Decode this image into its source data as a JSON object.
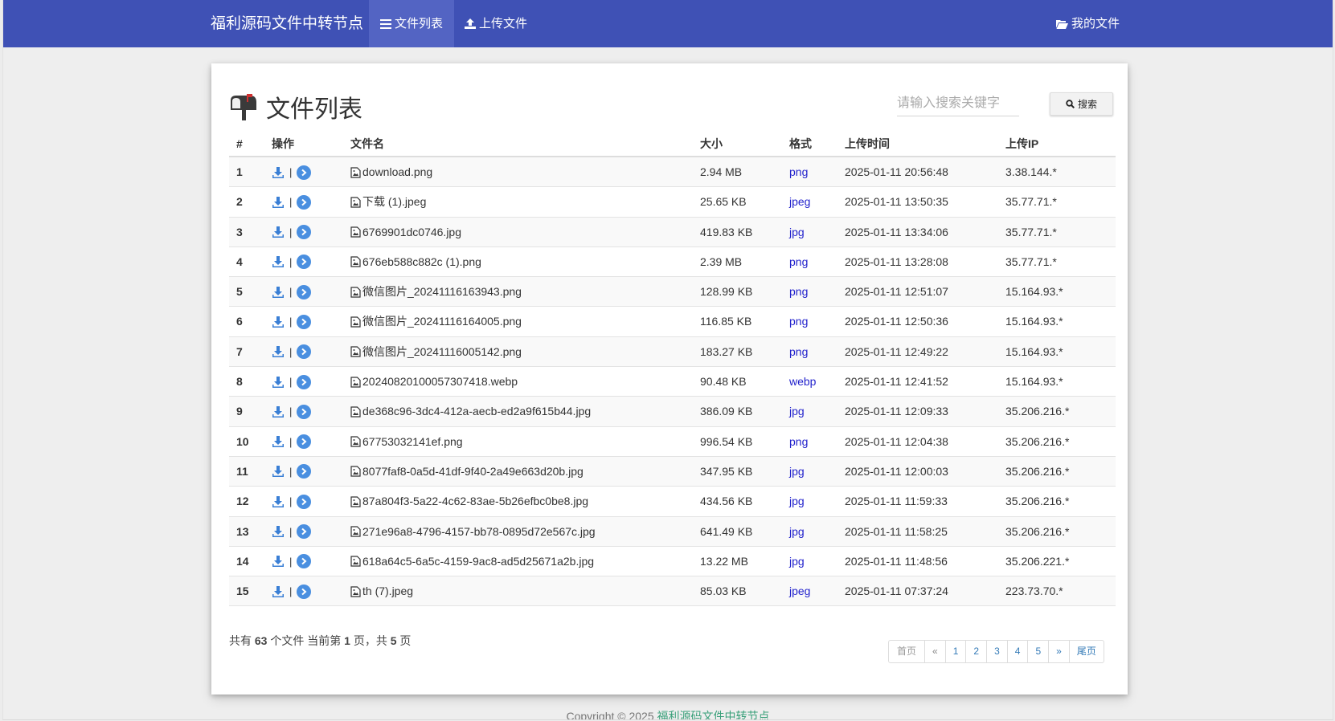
{
  "navbar": {
    "brand": "福利源码文件中转节点",
    "file_list": "文件列表",
    "upload": "上传文件",
    "my_files": "我的文件"
  },
  "page": {
    "title": "文件列表",
    "search_placeholder": "请输入搜索关键字",
    "search_label": "搜索"
  },
  "table": {
    "headers": {
      "num": "#",
      "op": "操作",
      "name": "文件名",
      "size": "大小",
      "format": "格式",
      "time": "上传时间",
      "ip": "上传IP"
    },
    "separator": "|",
    "rows": [
      {
        "num": "1",
        "name": "download.png",
        "size": "2.94 MB",
        "format": "png",
        "time": "2025-01-11 20:56:48",
        "ip": "3.38.144.*"
      },
      {
        "num": "2",
        "name": "下载 (1).jpeg",
        "size": "25.65 KB",
        "format": "jpeg",
        "time": "2025-01-11 13:50:35",
        "ip": "35.77.71.*"
      },
      {
        "num": "3",
        "name": "6769901dc0746.jpg",
        "size": "419.83 KB",
        "format": "jpg",
        "time": "2025-01-11 13:34:06",
        "ip": "35.77.71.*"
      },
      {
        "num": "4",
        "name": "676eb588c882c (1).png",
        "size": "2.39 MB",
        "format": "png",
        "time": "2025-01-11 13:28:08",
        "ip": "35.77.71.*"
      },
      {
        "num": "5",
        "name": "微信图片_20241116163943.png",
        "size": "128.99 KB",
        "format": "png",
        "time": "2025-01-11 12:51:07",
        "ip": "15.164.93.*"
      },
      {
        "num": "6",
        "name": "微信图片_20241116164005.png",
        "size": "116.85 KB",
        "format": "png",
        "time": "2025-01-11 12:50:36",
        "ip": "15.164.93.*"
      },
      {
        "num": "7",
        "name": "微信图片_20241116005142.png",
        "size": "183.27 KB",
        "format": "png",
        "time": "2025-01-11 12:49:22",
        "ip": "15.164.93.*"
      },
      {
        "num": "8",
        "name": "20240820100057307418.webp",
        "size": "90.48 KB",
        "format": "webp",
        "time": "2025-01-11 12:41:52",
        "ip": "15.164.93.*"
      },
      {
        "num": "9",
        "name": "de368c96-3dc4-412a-aecb-ed2a9f615b44.jpg",
        "size": "386.09 KB",
        "format": "jpg",
        "time": "2025-01-11 12:09:33",
        "ip": "35.206.216.*"
      },
      {
        "num": "10",
        "name": "67753032141ef.png",
        "size": "996.54 KB",
        "format": "png",
        "time": "2025-01-11 12:04:38",
        "ip": "35.206.216.*"
      },
      {
        "num": "11",
        "name": "8077faf8-0a5d-41df-9f40-2a49e663d20b.jpg",
        "size": "347.95 KB",
        "format": "jpg",
        "time": "2025-01-11 12:00:03",
        "ip": "35.206.216.*"
      },
      {
        "num": "12",
        "name": "87a804f3-5a22-4c62-83ae-5b26efbc0be8.jpg",
        "size": "434.56 KB",
        "format": "jpg",
        "time": "2025-01-11 11:59:33",
        "ip": "35.206.216.*"
      },
      {
        "num": "13",
        "name": "271e96a8-4796-4157-bb78-0895d72e567c.jpg",
        "size": "641.49 KB",
        "format": "jpg",
        "time": "2025-01-11 11:58:25",
        "ip": "35.206.216.*"
      },
      {
        "num": "14",
        "name": "618a64c5-6a5c-4159-9ac8-ad5d25671a2b.jpg",
        "size": "13.22 MB",
        "format": "jpg",
        "time": "2025-01-11 11:48:56",
        "ip": "35.206.221.*"
      },
      {
        "num": "15",
        "name": "th (7).jpeg",
        "size": "85.03 KB",
        "format": "jpeg",
        "time": "2025-01-11 07:37:24",
        "ip": "223.73.70.*"
      }
    ]
  },
  "summary": {
    "prefix": "共有",
    "total": "63",
    "mid1": "个文件 当前第",
    "current": "1",
    "mid2": "页，共",
    "pages": "5",
    "suffix": "页"
  },
  "pagination": {
    "first": "首页",
    "prev": "«",
    "pages": [
      "1",
      "2",
      "3",
      "4",
      "5"
    ],
    "next": "»",
    "last": "尾页"
  },
  "footer": {
    "copyright": "Copyright © 2025",
    "link": "福利源码文件中转节点"
  },
  "colors": {
    "navbar": "#3f51b5",
    "nav_active": "#5364c3",
    "format_link": "#2222cc",
    "page_link": "#337ab7",
    "footer_link": "#3aa07a"
  }
}
